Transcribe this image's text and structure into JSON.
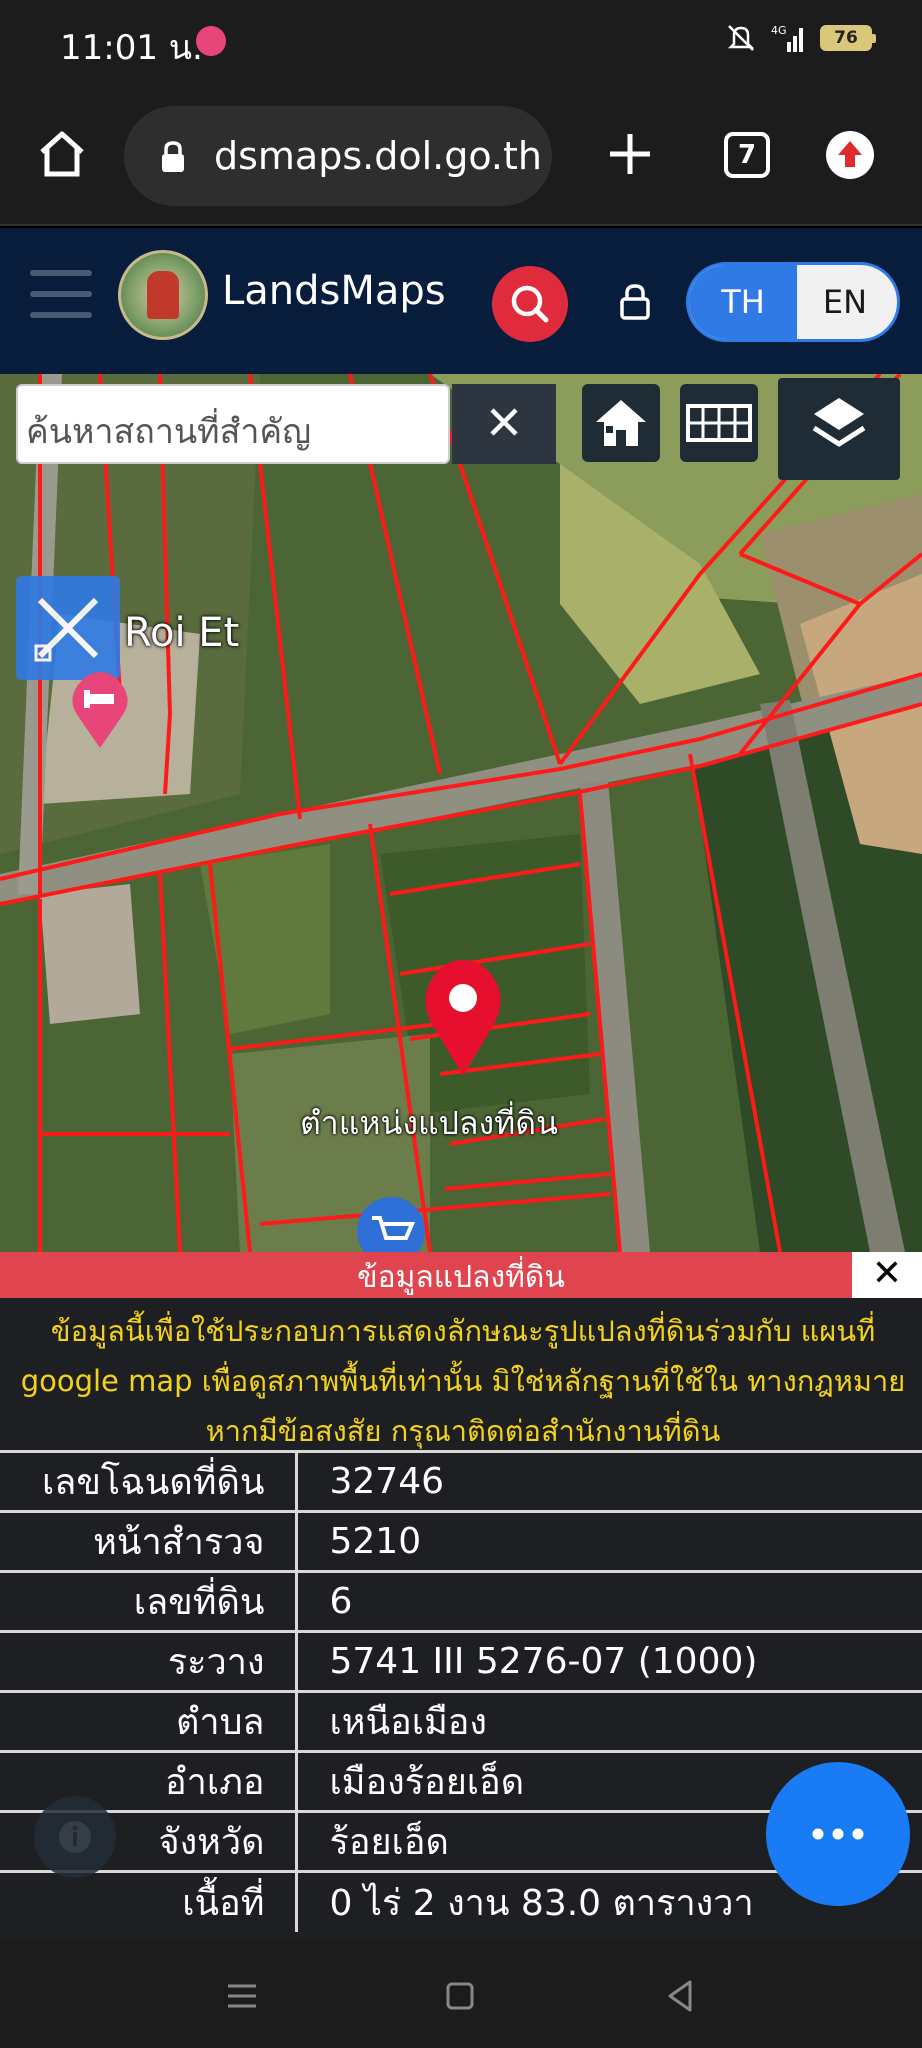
{
  "status_bar": {
    "time": "11:01 น.",
    "battery": "76",
    "icons": [
      "panda-app-icon",
      "mute-icon",
      "signal-4g-icon",
      "battery-icon"
    ]
  },
  "browser": {
    "url": "dsmaps.dol.go.th",
    "tab_count": "7",
    "icons": [
      "home-icon",
      "lock-icon",
      "plus-icon",
      "tabs-icon",
      "update-arrow-icon"
    ]
  },
  "header": {
    "title": "LandsMaps",
    "lang_th": "TH",
    "lang_en": "EN",
    "active_lang": "TH",
    "accent": "#2f7ae5",
    "search_color": "#e02b3c"
  },
  "map": {
    "search_placeholder": "ค้นหาสถานที่สำคัญ",
    "place_label": "Roi Et",
    "pin_label": "ตำแหน่งแปลงที่ดิน",
    "parcel_line_color": "#ff1a1a"
  },
  "info": {
    "bar_title": "ข้อมูลแปลงที่ดิน",
    "close_label": "✕",
    "disclaimer": "ข้อมูลนี้เพื่อใช้ประกอบการแสดงลักษณะรูปแปลงที่ดินร่วมกับ แผนที่ google map เพื่อดูสภาพพื้นที่เท่านั้น มิใช่หลักฐานที่ใช้ใน ทางกฎหมาย หากมีข้อสงสัย กรุณาติดต่อสำนักงานที่ดิน",
    "rows": [
      {
        "label": "เลขโฉนดที่ดิน",
        "value": "32746"
      },
      {
        "label": "หน้าสำรวจ",
        "value": "5210"
      },
      {
        "label": "เลขที่ดิน",
        "value": "6"
      },
      {
        "label": "ระวาง",
        "value": "5741 III 5276-07 (1000)"
      },
      {
        "label": "ตำบล",
        "value": "เหนือเมือง"
      },
      {
        "label": "อำเภอ",
        "value": "เมืองร้อยเอ็ด"
      },
      {
        "label": "จังหวัด",
        "value": "ร้อยเอ็ด"
      },
      {
        "label": "เนื้อที่",
        "value": "0 ไร่ 2 งาน 83.0 ตารางวา"
      }
    ]
  }
}
